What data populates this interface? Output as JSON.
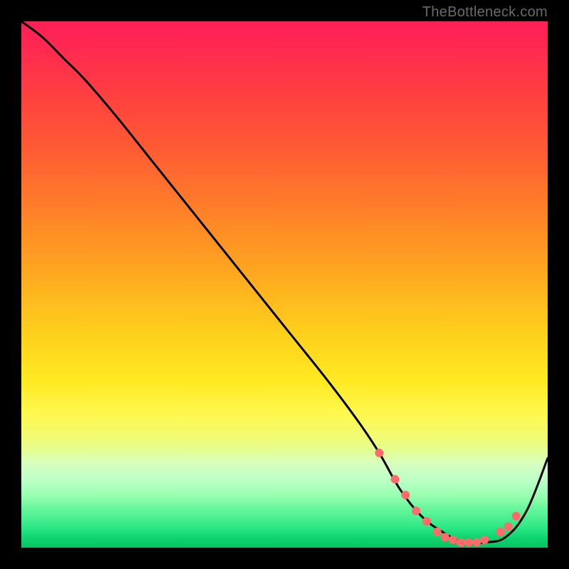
{
  "watermark": "TheBottleneck.com",
  "chart_data": {
    "type": "line",
    "title": "",
    "xlabel": "",
    "ylabel": "",
    "xlim": [
      0,
      100
    ],
    "ylim": [
      0,
      100
    ],
    "grid": false,
    "series": [
      {
        "name": "bottleneck-curve",
        "color": "#000000",
        "x": [
          0,
          4,
          8,
          12,
          18,
          26,
          34,
          42,
          50,
          58,
          64,
          68,
          72,
          76,
          80,
          84,
          88,
          92,
          96,
          100
        ],
        "y": [
          100,
          97,
          93,
          89,
          82,
          72,
          62,
          52,
          42,
          32,
          24,
          18,
          11,
          6,
          3,
          1,
          1,
          2,
          7,
          17
        ]
      }
    ],
    "markers": {
      "name": "highlight-dots",
      "color": "#ff6b6b",
      "radius": 6,
      "points": [
        {
          "x": 68,
          "y": 18
        },
        {
          "x": 71,
          "y": 13
        },
        {
          "x": 73,
          "y": 10
        },
        {
          "x": 75,
          "y": 7
        },
        {
          "x": 77,
          "y": 5
        },
        {
          "x": 79,
          "y": 3
        },
        {
          "x": 80.5,
          "y": 2
        },
        {
          "x": 82,
          "y": 1.5
        },
        {
          "x": 83.5,
          "y": 1
        },
        {
          "x": 85,
          "y": 1
        },
        {
          "x": 86.5,
          "y": 1
        },
        {
          "x": 88,
          "y": 1.5
        },
        {
          "x": 91,
          "y": 3
        },
        {
          "x": 92.5,
          "y": 4
        },
        {
          "x": 94,
          "y": 6
        }
      ]
    }
  }
}
